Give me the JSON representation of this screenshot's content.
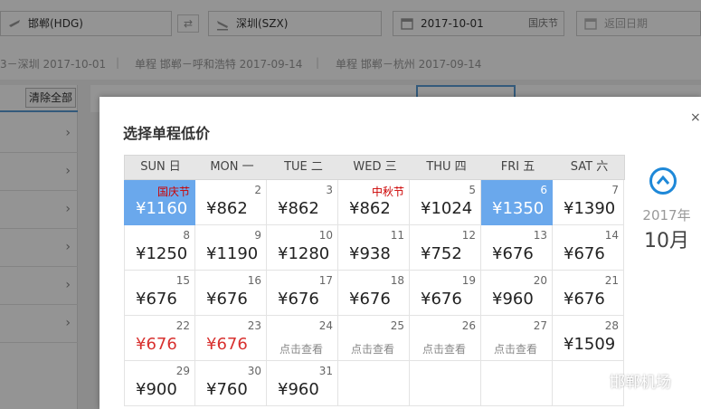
{
  "search": {
    "from": "邯郸(HDG)",
    "to": "深圳(SZX)",
    "depart_date": "2017-10-01",
    "depart_tag": "国庆节",
    "return_placeholder": "返回日期",
    "swap_icon": "swap-icon"
  },
  "history": [
    {
      "text": "3－深圳 2017-10-01"
    },
    {
      "text": "单程 邯郸－呼和浩特 2017-09-14"
    },
    {
      "text": "单程 邯郸－杭州 2017-09-14"
    }
  ],
  "sidebar": {
    "clear_label": "清除全部"
  },
  "modal": {
    "title": "选择单程低价",
    "close_icon": "close-icon",
    "year": "2017年",
    "month": "10月",
    "accent_color": "#1e88d8",
    "selected_color": "#6aa8ec"
  },
  "calendar": {
    "weekdays": [
      "SUN 日",
      "MON 一",
      "TUE 二",
      "WED 三",
      "THU 四",
      "FRI 五",
      "SAT 六"
    ],
    "weeks": [
      [
        {
          "day": "国庆节",
          "holiday": true,
          "price": "¥1160",
          "selected": true
        },
        {
          "day": "2",
          "price": "¥862"
        },
        {
          "day": "3",
          "price": "¥862"
        },
        {
          "day": "中秋节",
          "holiday": true,
          "price": "¥862"
        },
        {
          "day": "5",
          "price": "¥1024"
        },
        {
          "day": "6",
          "price": "¥1350",
          "selected": true
        },
        {
          "day": "7",
          "price": "¥1390"
        }
      ],
      [
        {
          "day": "8",
          "price": "¥1250"
        },
        {
          "day": "9",
          "price": "¥1190"
        },
        {
          "day": "10",
          "price": "¥1280"
        },
        {
          "day": "11",
          "price": "¥938"
        },
        {
          "day": "12",
          "price": "¥752"
        },
        {
          "day": "13",
          "price": "¥676"
        },
        {
          "day": "14",
          "price": "¥676"
        }
      ],
      [
        {
          "day": "15",
          "price": "¥676"
        },
        {
          "day": "16",
          "price": "¥676"
        },
        {
          "day": "17",
          "price": "¥676"
        },
        {
          "day": "18",
          "price": "¥676"
        },
        {
          "day": "19",
          "price": "¥676"
        },
        {
          "day": "20",
          "price": "¥960"
        },
        {
          "day": "21",
          "price": "¥676"
        }
      ],
      [
        {
          "day": "22",
          "price": "¥676",
          "cheap": true
        },
        {
          "day": "23",
          "price": "¥676",
          "cheap": true
        },
        {
          "day": "24",
          "check": "点击查看"
        },
        {
          "day": "25",
          "check": "点击查看"
        },
        {
          "day": "26",
          "check": "点击查看"
        },
        {
          "day": "27",
          "check": "点击查看"
        },
        {
          "day": "28",
          "price": "¥1509"
        }
      ],
      [
        {
          "day": "29",
          "price": "¥900"
        },
        {
          "day": "30",
          "price": "¥760"
        },
        {
          "day": "31",
          "price": "¥960"
        },
        {
          "empty": true
        },
        {
          "empty": true
        },
        {
          "empty": true
        },
        {
          "empty": true
        }
      ]
    ]
  },
  "watermark": {
    "text": "邯郸机场"
  }
}
